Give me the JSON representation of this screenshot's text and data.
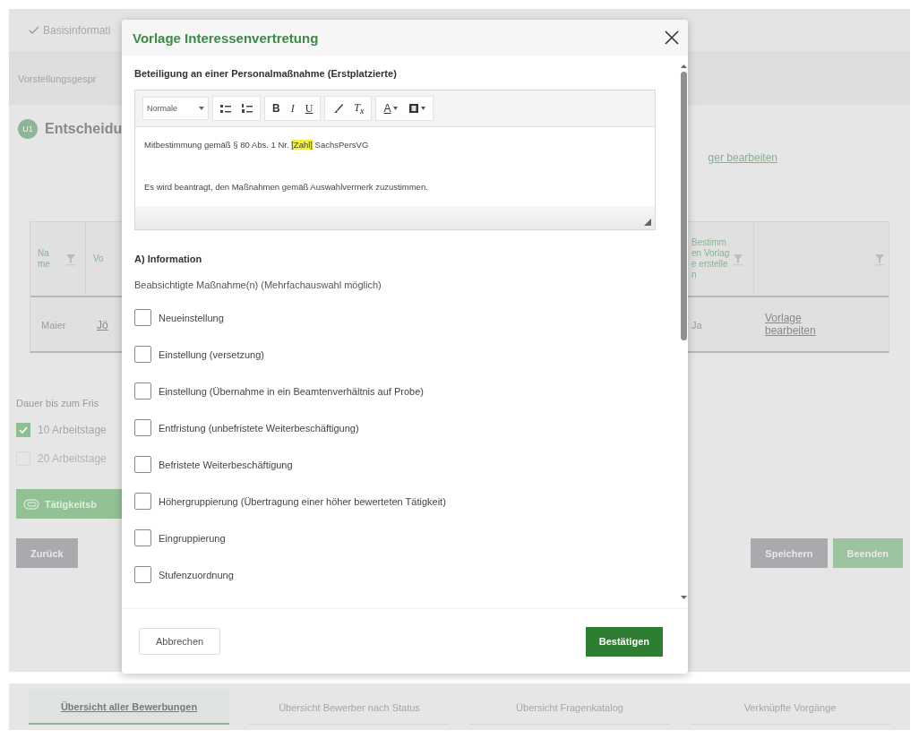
{
  "steps": [
    {
      "label": "Basisinformati",
      "checked": true
    }
  ],
  "subnav": {
    "label": "Vorstellungsgespr"
  },
  "section": {
    "badge": "U1",
    "title": "Entscheidu",
    "link": "ger bearbeiten"
  },
  "table": {
    "columns": [
      {
        "label": "Name",
        "filter": true
      },
      {
        "label": "Vo",
        "filter": false
      },
      {
        "label": "Bestimmen Vorlage erstellen",
        "filter": true
      },
      {
        "filter": true
      }
    ],
    "rows": [
      {
        "cells": [
          {
            "text": "Maier",
            "kind": "text"
          },
          {
            "text": "Jö",
            "kind": "link"
          },
          {
            "text": "Ja",
            "kind": "text"
          },
          {
            "text": "Vorlage bearbeiten",
            "kind": "link"
          }
        ]
      }
    ]
  },
  "deadline": {
    "label": "Dauer bis zum Fris",
    "options": [
      {
        "label": "10 Arbeitstage",
        "checked": true,
        "disabled": false
      },
      {
        "label": "20 Arbeitstage",
        "checked": false,
        "disabled": true
      }
    ]
  },
  "activity_button": "Tätigkeitsb",
  "back_button": "Zurück",
  "save_button": "Speichern",
  "finish_button": "Beenden",
  "bottom_tabs": [
    {
      "label": "Übersicht aller Bewerbungen",
      "selected": true
    },
    {
      "label": "Übersicht Bewerber nach Status",
      "selected": false
    },
    {
      "label": "Übersicht Fragenkatalog",
      "selected": false
    },
    {
      "label": "Verknüpfte Vorgänge",
      "selected": false
    }
  ],
  "dialog": {
    "title": "Vorlage Interessenvertretung",
    "section_title": "Beteiligung an einer Personalmaßnahme (Erstplatzierte)",
    "editor": {
      "format": "Normale",
      "toolbar": [
        [
          {
            "kind": "bullets"
          },
          {
            "kind": "numbers"
          }
        ],
        [
          {
            "kind": "bold",
            "label": "B"
          },
          {
            "kind": "italic",
            "label": "I"
          },
          {
            "kind": "underline",
            "label": "U"
          }
        ],
        [
          {
            "kind": "brush"
          },
          {
            "kind": "clear",
            "label": "T$_{x}$"
          }
        ],
        [
          {
            "kind": "color",
            "label": "A"
          },
          {
            "kind": "background"
          }
        ]
      ],
      "lines": [
        [
          {
            "text": "Mitbestimmung gemäß § 80 Abs. 1 Nr. ",
            "highlight": false
          },
          {
            "text": "[Zahl]",
            "highlight": true
          },
          {
            "text": " SachsPersVG",
            "highlight": false
          }
        ],
        [
          {
            "text": "Es wird beantragt, den Maßnahmen gemäß Auswahlvermerk zuzustimmen.",
            "highlight": false
          }
        ]
      ]
    },
    "info_heading": "A) Information",
    "info_hint": "Beabsichtigte Maßnahme(n) (Mehrfachauswahl möglich)",
    "options": [
      {
        "label": "Neueinstellung",
        "checked": false
      },
      {
        "label": "Einstellung (versetzung)",
        "checked": false
      },
      {
        "label": "Einstellung (Übernahme in ein Beamtenverhältnis auf Probe)",
        "checked": false
      },
      {
        "label": "Entfristung (unbefristete Weiterbeschäftigung)",
        "checked": false
      },
      {
        "label": "Befristete Weiterbeschäftigung",
        "checked": false
      },
      {
        "label": "Höhergruppierung (Übertragung einer höher bewerteten Tätigkeit)",
        "checked": false
      },
      {
        "label": "Eingruppierung",
        "checked": false
      },
      {
        "label": "Stufenzuordnung",
        "checked": false
      }
    ],
    "cancel_button": "Abbrechen",
    "confirm_button": "Bestätigen"
  }
}
